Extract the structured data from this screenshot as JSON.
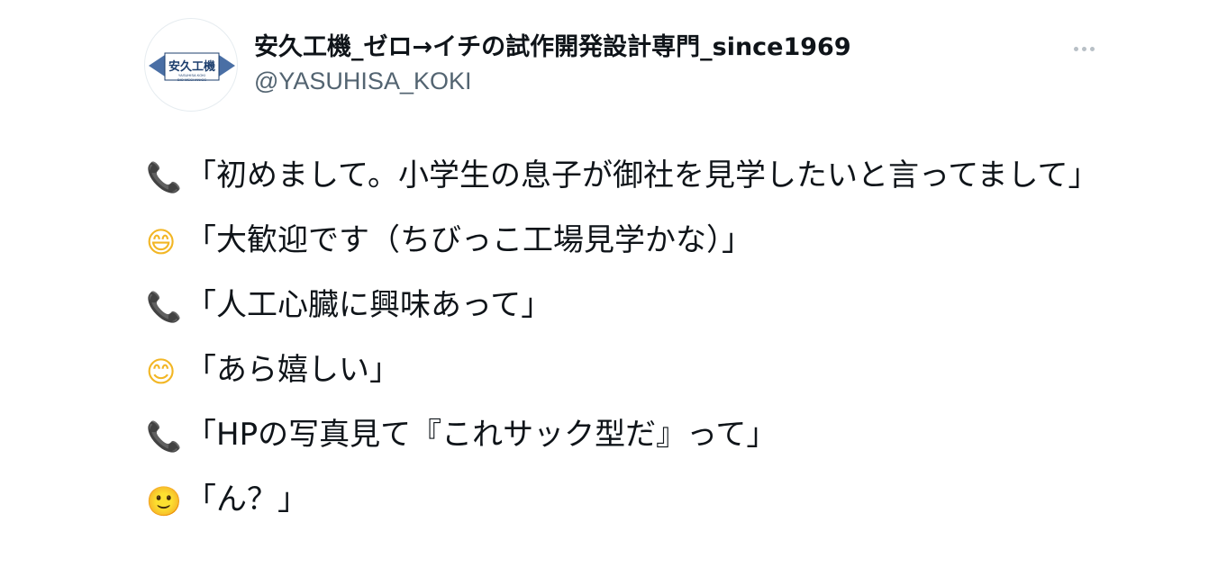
{
  "author": {
    "display_name": "安久工機_ゼロ→イチの試作開発設計専門_since1969",
    "handle": "@YASUHISA_KOKI",
    "avatar_logo": {
      "main_text": "安久工機",
      "sub_text_1": "YASUHISA KOKI",
      "sub_text_2": "BIO MECHANICS"
    }
  },
  "more_icon": "more-horizontal-icon",
  "lines": [
    {
      "emoji": "📞",
      "emoji_name": "telephone-receiver-icon",
      "text": "「初めまして。小学生の息子が御社を見学したいと言ってまして」"
    },
    {
      "emoji": "😄",
      "emoji_name": "grinning-face-icon",
      "text": "「大歓迎です（ちびっこ工場見学かな）」"
    },
    {
      "emoji": "📞",
      "emoji_name": "telephone-receiver-icon",
      "text": "「人工心臓に興味あって」"
    },
    {
      "emoji": "😊",
      "emoji_name": "smiling-face-icon",
      "text": "「あら嬉しい」"
    },
    {
      "emoji": "📞",
      "emoji_name": "telephone-receiver-icon",
      "text": "「HPの写真見て『これサック型だ』って」"
    },
    {
      "emoji": "🙂",
      "emoji_name": "slightly-smiling-face-icon",
      "text": "「ん？」"
    }
  ],
  "colors": {
    "text": "#0f1419",
    "secondary": "#536471",
    "logo_navy": "#1d3f6e",
    "logo_blue": "#4a6fa5"
  }
}
